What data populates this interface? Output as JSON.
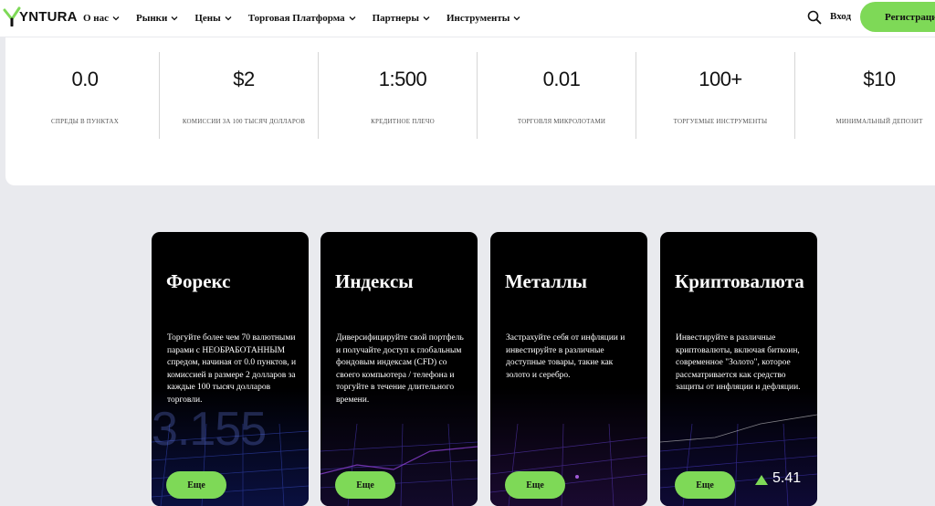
{
  "header": {
    "logo_text": "YNTURA",
    "nav": [
      {
        "label": "О нас"
      },
      {
        "label": "Рынки"
      },
      {
        "label": "Цены"
      },
      {
        "label": "Торговая Платформа"
      },
      {
        "label": "Партнеры"
      },
      {
        "label": "Инструменты"
      }
    ],
    "login_label": "Вход",
    "register_label": "Регистрация",
    "accent_color": "#7ed957"
  },
  "stats": [
    {
      "value": "0.0",
      "label": "спреды в пунктах"
    },
    {
      "value": "$2",
      "label": "комиссии за 100 тысяч долларов"
    },
    {
      "value": "1:500",
      "label": "кредитное плечо"
    },
    {
      "value": "0.01",
      "label": "торговля микролотами"
    },
    {
      "value": "100+",
      "label": "торгуемые инструменты"
    },
    {
      "value": "$10",
      "label": "минимальный депозит"
    }
  ],
  "cards": [
    {
      "title": "Форекс",
      "text": "Торгуйте более чем 70 валютными парами с НЕОБРАБОТАННЫМ спредом, начиная от 0.0 пунктов, и комиссией в размере 2 долларов за каждые 100 тысяч долларов торговли.",
      "button": "Еще",
      "bg_text": "3.155"
    },
    {
      "title": "Индексы",
      "text": "Диверсифицируйте свой портфель и получайте доступ к глобальным фондовым индексам (CFD) со своего компьютера / телефона и торгуйте в течение длительного времени.",
      "button": "Еще"
    },
    {
      "title": "Металлы",
      "text": "Застрахуйте себя от инфляции и инвестируйте в различные доступные товары, такие как золото и серебро.",
      "button": "Еще"
    },
    {
      "title": "Криптовалюта",
      "text": "Инвестируйте в различные криптовалюты, включая биткоин, современное \"Золото\", которое рассматривается как средство защиты от инфляции и дефляции.",
      "button": "Еще",
      "ticker": "5.41"
    }
  ]
}
